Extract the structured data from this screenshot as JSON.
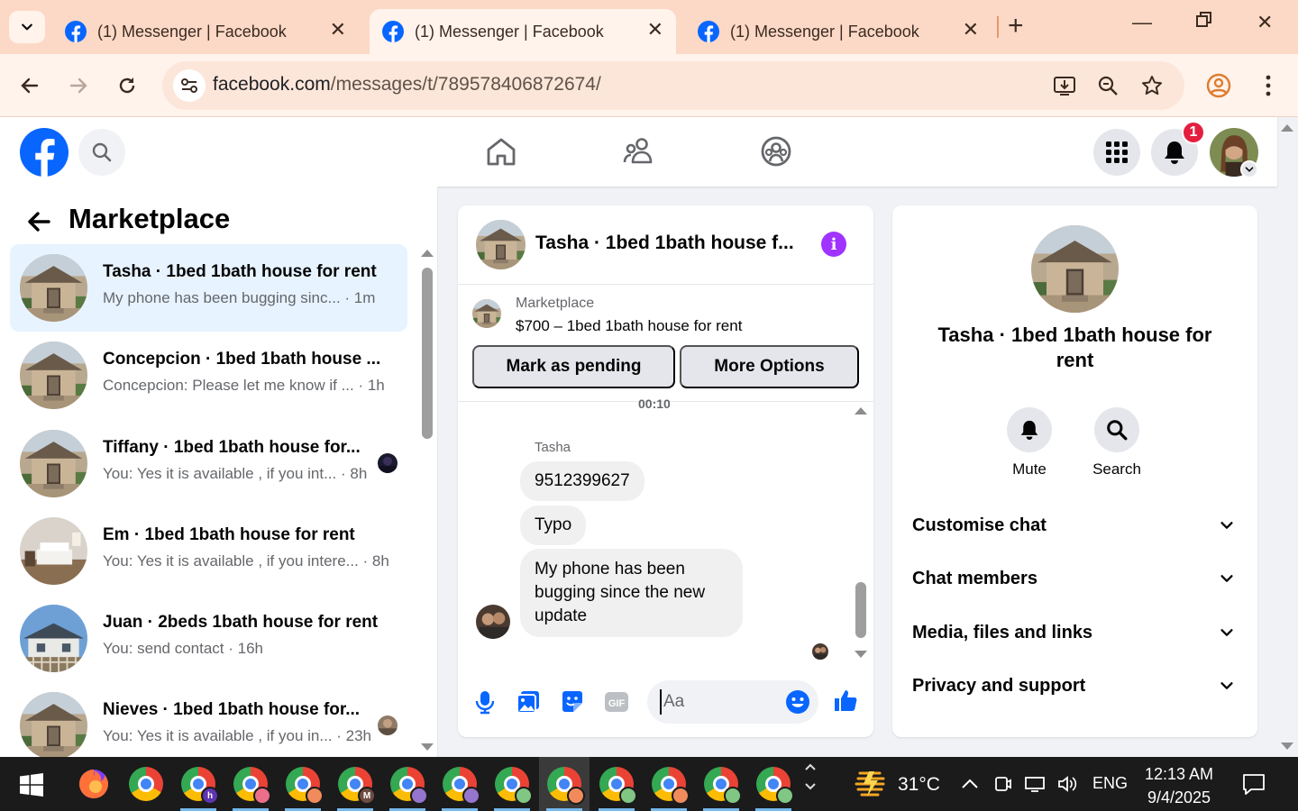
{
  "browser": {
    "tabs": [
      {
        "title": "(1) Messenger | Facebook"
      },
      {
        "title": "(1) Messenger | Facebook"
      },
      {
        "title": "(1) Messenger | Facebook"
      }
    ],
    "url_host": "facebook.com",
    "url_path": "/messages/t/789578406872674/"
  },
  "header": {
    "notification_count": "1"
  },
  "left_panel": {
    "title": "Marketplace",
    "conversations": [
      {
        "name": "Tasha · 1bed 1bath house for rent",
        "snippet": "My phone has been bugging sinc... · 1m",
        "thumb": "house"
      },
      {
        "name": "Concepcion · 1bed 1bath house ...",
        "snippet": "Concepcion: Please let me know if ... · 1h",
        "thumb": "house"
      },
      {
        "name": "Tiffany · 1bed 1bath house for...",
        "snippet": "You: Yes it is available , if you int... · 8h",
        "thumb": "house"
      },
      {
        "name": "Em · 1bed 1bath house for rent",
        "snippet": "You: Yes it is available , if you intere... · 8h",
        "thumb": "room"
      },
      {
        "name": "Juan · 2beds 1bath house for rent",
        "snippet": "You: send contact · 16h",
        "thumb": "house2"
      },
      {
        "name": "Nieves · 1bed 1bath house for...",
        "snippet": "You: Yes it is available , if you in... · 23h",
        "thumb": "house"
      }
    ]
  },
  "chat": {
    "title": "Tasha · 1bed 1bath house f...",
    "listing_source": "Marketplace",
    "listing_price": "$700 – 1bed 1bath house for rent",
    "mark_pending_label": "Mark as pending",
    "more_options_label": "More Options",
    "time_separator": "00:10",
    "sender": "Tasha",
    "messages": [
      "9512399627",
      "Typo",
      "My phone has been bugging since the new update"
    ],
    "composer_placeholder": "Aa"
  },
  "right_panel": {
    "name": "Tasha · 1bed 1bath house for rent",
    "mute_label": "Mute",
    "search_label": "Search",
    "sections": [
      "Customise chat",
      "Chat members",
      "Media, files and links",
      "Privacy and support"
    ]
  },
  "taskbar": {
    "temperature": "31°C",
    "language": "ENG",
    "time": "12:13 AM",
    "date": "9/4/2025"
  },
  "colors": {
    "fb_blue": "#0866ff",
    "messenger_purple": "#a033ff",
    "tab_strip": "#fcd9c6",
    "badge_red": "#e41e3f"
  }
}
